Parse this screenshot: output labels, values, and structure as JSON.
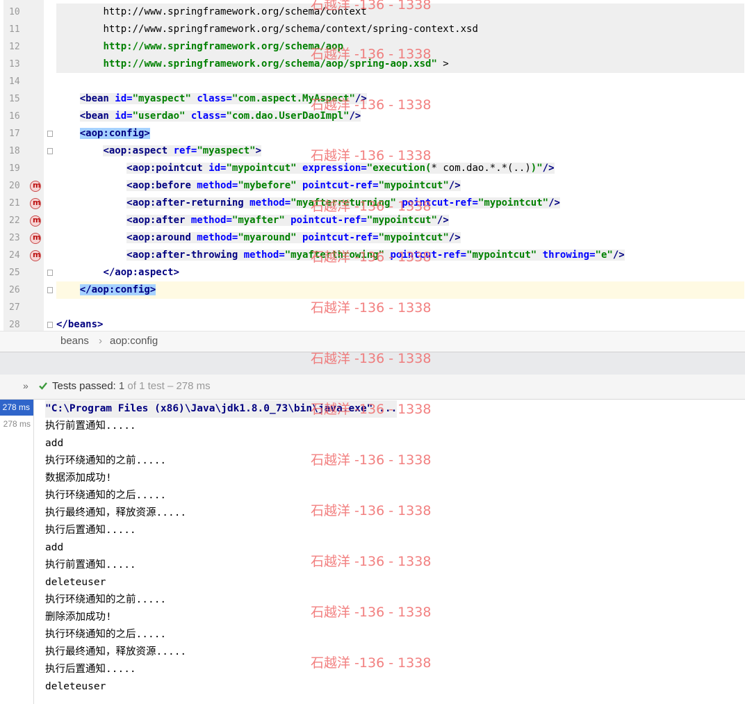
{
  "editor": {
    "line_numbers": [
      "10",
      "11",
      "12",
      "13",
      "14",
      "15",
      "16",
      "17",
      "18",
      "19",
      "20",
      "21",
      "22",
      "23",
      "24",
      "25",
      "26",
      "27",
      "28"
    ],
    "lines": {
      "l10": "http://www.springframework.org/schema/context",
      "l11": "http://www.springframework.org/schema/context/spring-context.xsd",
      "l12": "http://www.springframework.org/schema/aop",
      "l13a": "http://www.springframework.org/schema/aop/spring-aop.xsd\"",
      "l13b": " >",
      "bean1": {
        "tag": "<bean",
        "id_attr": " id=",
        "id_val": "\"myaspect\"",
        "class_attr": " class=",
        "class_val": "\"com.aspect.MyAspect\"",
        "close": "/>"
      },
      "bean2": {
        "tag": "<bean",
        "id_attr": " id=",
        "id_val": "\"userdao\"",
        "class_attr": " class=",
        "class_val": "\"com.dao.UserDaoImpl\"",
        "close": "/>"
      },
      "aop_config_open": "<aop:config>",
      "aspect_open": {
        "tag": "<aop:aspect",
        "attr": " ref=",
        "val": "\"myaspect\"",
        "close": ">"
      },
      "pointcut": {
        "tag": "<aop:pointcut",
        "a1": " id=",
        "v1": "\"mypointcut\"",
        "a2": " expression=",
        "v2a": "\"execution(",
        "v2b": "* com.dao.*.*(..)",
        "v2c": ")\"",
        "close": "/>"
      },
      "before": {
        "tag": "<aop:before",
        "a1": " method=",
        "v1": "\"mybefore\"",
        "a2": " pointcut-ref=",
        "v2": "\"mypointcut\"",
        "close": "/>"
      },
      "after_returning": {
        "tag": "<aop:after-returning",
        "a1": " method=",
        "v1": "\"myafterreturning\"",
        "a2": " pointcut-ref=",
        "v2": "\"mypointcut\"",
        "close": "/>"
      },
      "after": {
        "tag": "<aop:after",
        "a1": " method=",
        "v1": "\"myafter\"",
        "a2": " pointcut-ref=",
        "v2": "\"mypointcut\"",
        "close": "/>"
      },
      "around": {
        "tag": "<aop:around",
        "a1": " method=",
        "v1": "\"myaround\"",
        "a2": " pointcut-ref=",
        "v2": "\"mypointcut\"",
        "close": "/>"
      },
      "after_throwing": {
        "tag": "<aop:after-throwing",
        "a1": " method=",
        "v1": "\"myafterthrowing\"",
        "a2": " pointcut-ref=",
        "v2": "\"mypointcut\"",
        "a3": " throwing=",
        "v3": "\"e\"",
        "close": "/>"
      },
      "aspect_close": "</aop:aspect>",
      "aop_config_close": "</aop:config>",
      "beans_close": "</beans>"
    }
  },
  "breadcrumb": {
    "items": [
      "beans",
      "aop:config"
    ],
    "separator": "›"
  },
  "run": {
    "status_label": "Tests passed:",
    "status_count": "1",
    "status_rest": "of 1 test – 278 ms",
    "tree": [
      "278 ms",
      "278 ms"
    ],
    "console": [
      "\"C:\\Program Files (x86)\\Java\\jdk1.8.0_73\\bin\\java.exe\" ...",
      "执行前置通知.....",
      "add",
      "执行环绕通知的之前.....",
      "数据添加成功!",
      "执行环绕通知的之后.....",
      "执行最终通知，释放资源.....",
      "执行后置通知.....",
      "add",
      "执行前置通知.....",
      "deleteuser",
      "执行环绕通知的之前.....",
      "删除添加成功!",
      "执行环绕通知的之后.....",
      "执行最终通知，释放资源.....",
      "执行后置通知.....",
      "deleteuser"
    ]
  },
  "watermark": "石越洋 -136 - 1338",
  "colors": {
    "tag": "#000080",
    "attr": "#0000ff",
    "value": "#008000",
    "selection": "#a6d2ff",
    "run_selected": "#2f65ca",
    "watermark": "#f06b6b"
  }
}
